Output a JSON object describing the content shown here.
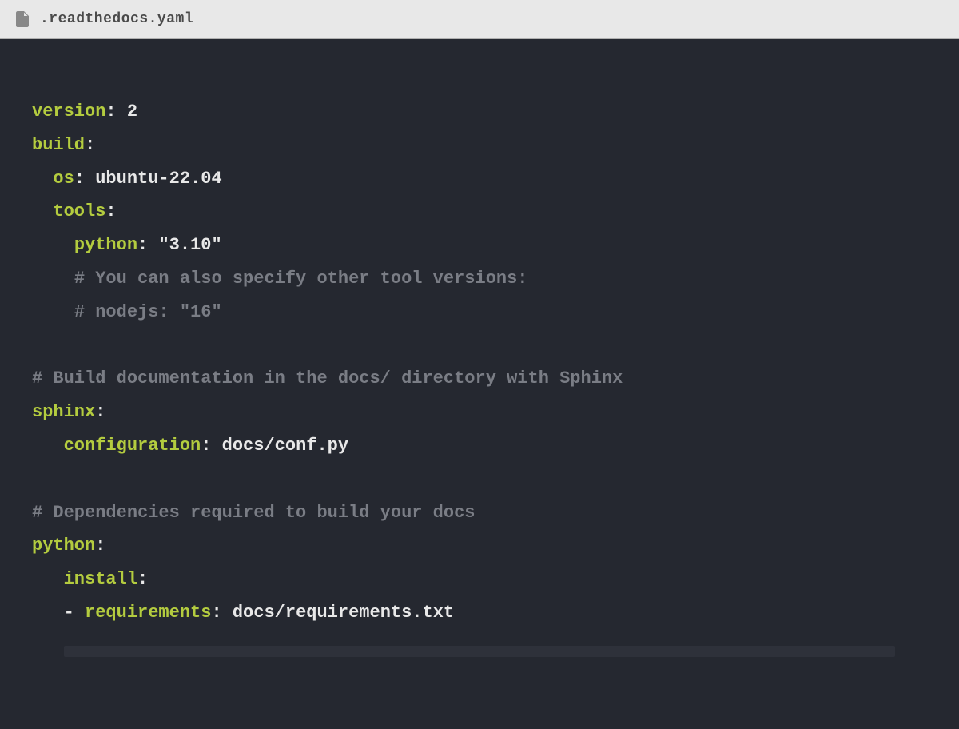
{
  "header": {
    "filename": ".readthedocs.yaml"
  },
  "code": {
    "line1_key": "version",
    "line1_punct": ": ",
    "line1_value": "2",
    "line2_key": "build",
    "line2_punct": ":",
    "line3_indent": "  ",
    "line3_key": "os",
    "line3_punct": ": ",
    "line3_value": "ubuntu-22.04",
    "line4_indent": "  ",
    "line4_key": "tools",
    "line4_punct": ":",
    "line5_indent": "    ",
    "line5_key": "python",
    "line5_punct": ": ",
    "line5_value": "\"3.10\"",
    "line6_indent": "    ",
    "line6_comment": "# You can also specify other tool versions:",
    "line7_indent": "    ",
    "line7_comment": "# nodejs: \"16\"",
    "line8_blank": " ",
    "line9_comment": "# Build documentation in the docs/ directory with Sphinx",
    "line10_key": "sphinx",
    "line10_punct": ":",
    "line11_indent": "   ",
    "line11_key": "configuration",
    "line11_punct": ": ",
    "line11_value": "docs/conf.py",
    "line12_blank": " ",
    "line13_comment": "# Dependencies required to build your docs",
    "line14_key": "python",
    "line14_punct": ":",
    "line15_indent": "   ",
    "line15_key": "install",
    "line15_punct": ":",
    "line16_indent": "   ",
    "line16_dash": "- ",
    "line16_key": "requirements",
    "line16_punct": ": ",
    "line16_value": "docs/requirements.txt"
  }
}
